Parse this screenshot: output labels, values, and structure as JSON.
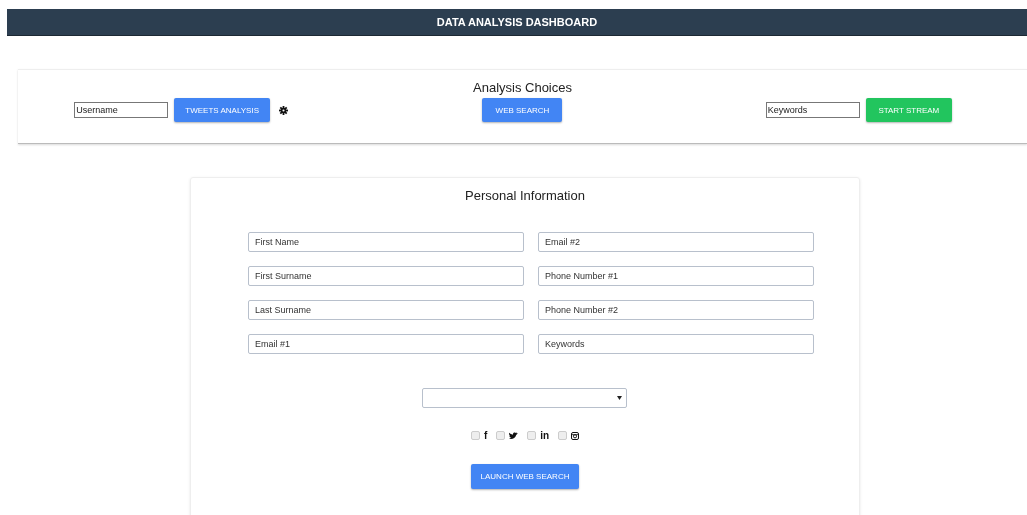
{
  "header": {
    "title": "DATA ANALYSIS DASHBOARD"
  },
  "analysis": {
    "title": "Analysis Choices",
    "username": {
      "placeholder": "Username"
    },
    "tweets_button": "TWEETS ANALYSIS",
    "web_search_button": "WEB SEARCH",
    "keywords": {
      "placeholder": "Keywords"
    },
    "stream_button": "START STREAM"
  },
  "personal": {
    "title": "Personal Information",
    "fields": [
      {
        "placeholder": "First Name"
      },
      {
        "placeholder": "Email #2"
      },
      {
        "placeholder": "First Surname"
      },
      {
        "placeholder": "Phone Number #1"
      },
      {
        "placeholder": "Last Surname"
      },
      {
        "placeholder": "Phone Number #2"
      },
      {
        "placeholder": "Email #1"
      },
      {
        "placeholder": "Keywords"
      }
    ],
    "socials": [
      {
        "kind": "glyph",
        "label": "f",
        "checked": false
      },
      {
        "kind": "bird",
        "checked": false
      },
      {
        "kind": "glyph",
        "label": "in",
        "checked": false
      },
      {
        "kind": "camera",
        "checked": false
      }
    ],
    "launch_button": "LAUNCH WEB SEARCH"
  }
}
